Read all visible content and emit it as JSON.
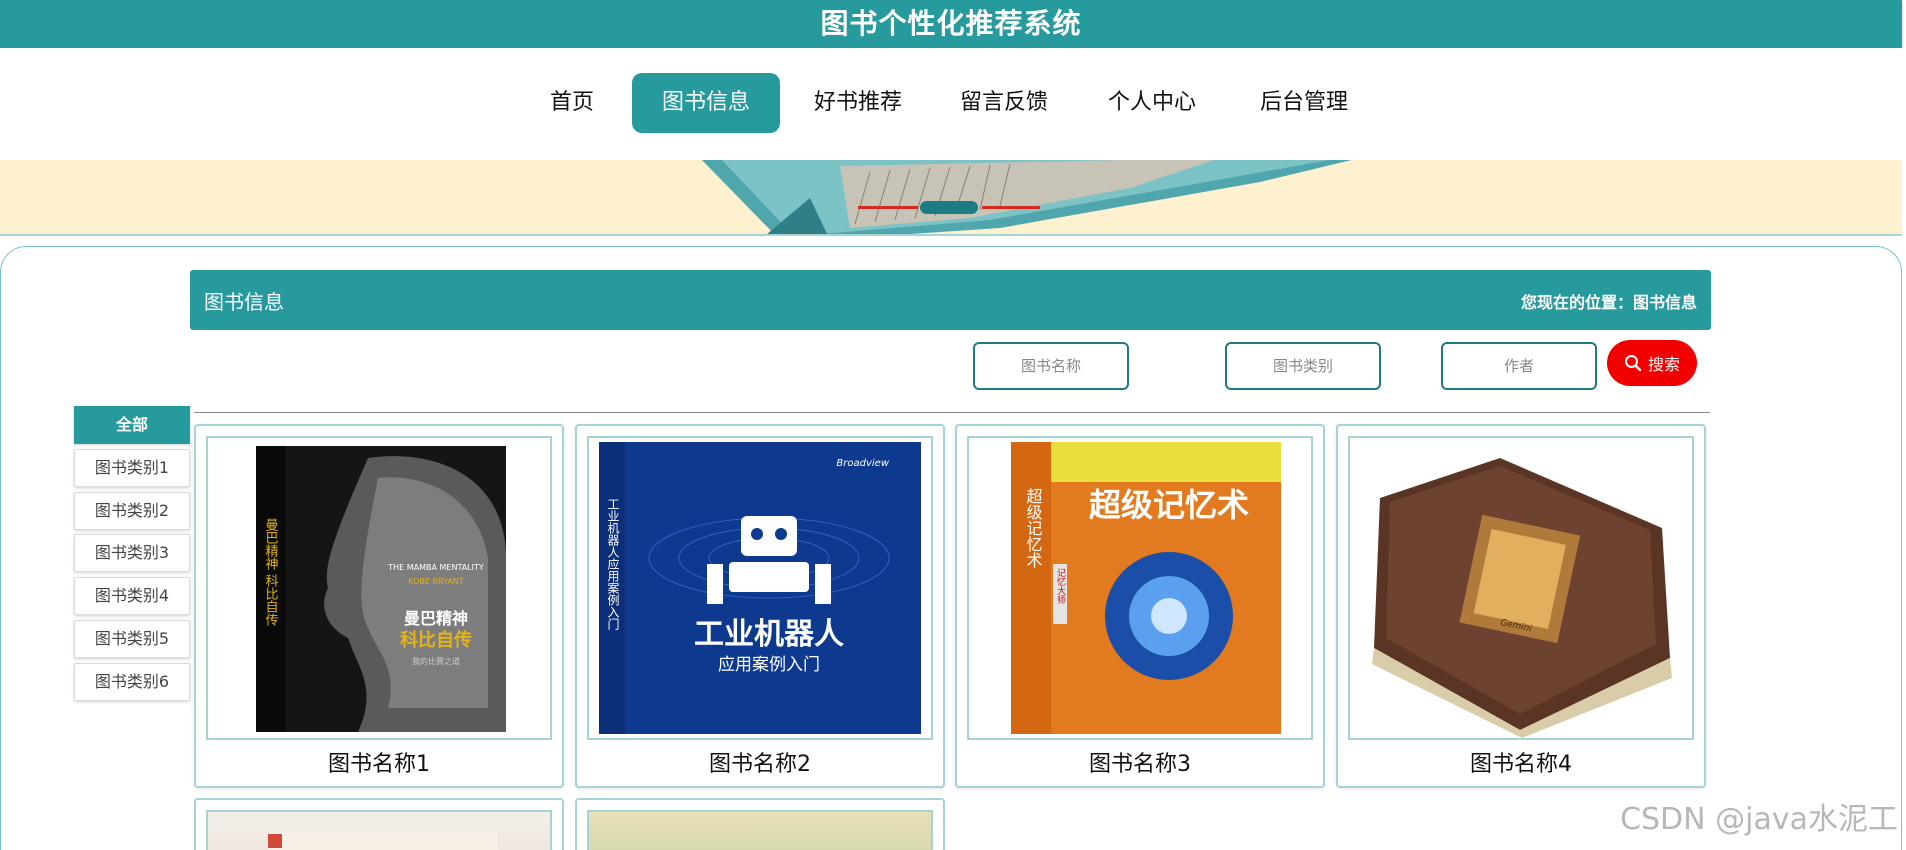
{
  "site": {
    "title": "图书个性化推荐系统"
  },
  "nav": {
    "items": [
      {
        "label": "首页",
        "active": false
      },
      {
        "label": "图书信息",
        "active": true
      },
      {
        "label": "好书推荐",
        "active": false
      },
      {
        "label": "留言反馈",
        "active": false
      },
      {
        "label": "个人中心",
        "active": false
      },
      {
        "label": "后台管理",
        "active": false
      }
    ]
  },
  "banner": {
    "slides": 3,
    "active_slide": 2
  },
  "section": {
    "title": "图书信息",
    "location": "您现在的位置：图书信息"
  },
  "search": {
    "name_placeholder": "图书名称",
    "category_placeholder": "图书类别",
    "author_placeholder": "作者",
    "button_label": "搜索"
  },
  "categories": [
    "全部",
    "图书类别1",
    "图书类别2",
    "图书类别3",
    "图书类别4",
    "图书类别5",
    "图书类别6"
  ],
  "books": [
    {
      "name": "图书名称1",
      "cover": "Kobe Bryant biography, black cover"
    },
    {
      "name": "图书名称2",
      "cover": "Industrial robot textbook, blue cover"
    },
    {
      "name": "图书名称3",
      "cover": "Super memory book, orange cover"
    },
    {
      "name": "图书名称4",
      "cover": "Antique leather-bound book"
    }
  ],
  "covers": {
    "book1": {
      "title": "曼巴精神",
      "subtitle": "科比自传",
      "en": "THE MAMBA MENTALITY",
      "author": "KOBE BRYANT",
      "spine": "曼巴精神 科比自传",
      "note": "我的比赛之道"
    },
    "book2": {
      "title": "工业机器人",
      "subtitle": "应用案例入门",
      "spine": "工业机器人应用案例入门",
      "brand": "Broadview"
    },
    "book3": {
      "title": "超级记忆术",
      "spine": "超级记忆术",
      "badge": "记忆大师"
    },
    "book4": {
      "label": "Gemini"
    }
  },
  "watermark": "CSDN @java水泥工",
  "colors": {
    "teal": "#279a9d",
    "search_red": "#f20000",
    "banner_bg": "#fdf1d0"
  }
}
